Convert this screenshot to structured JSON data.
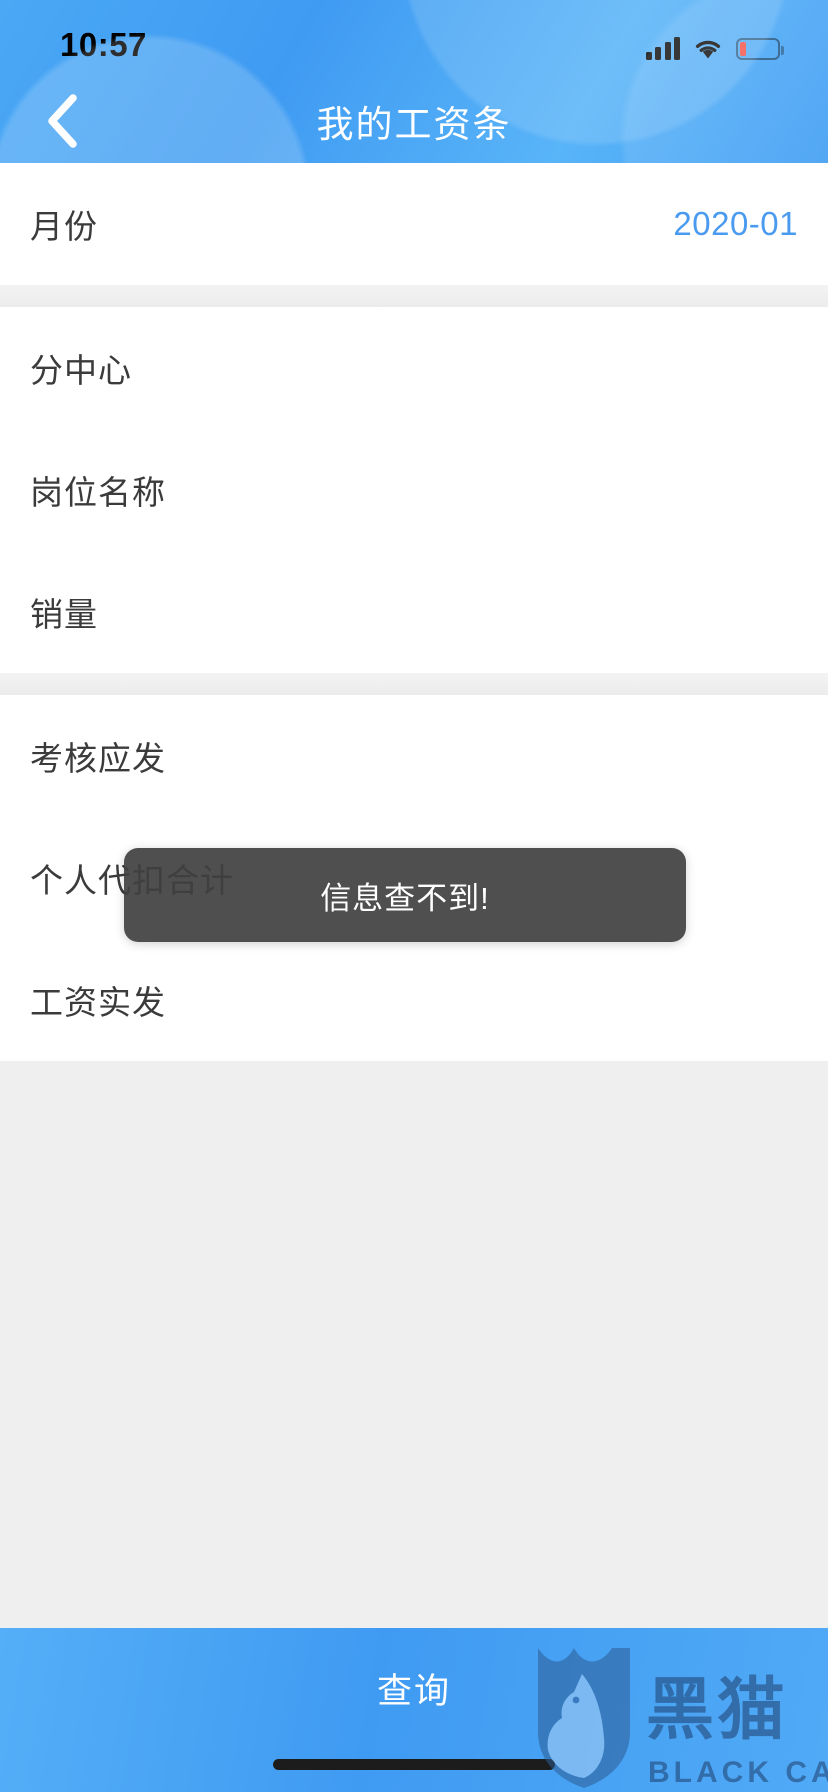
{
  "status_bar": {
    "time": "10:57",
    "signal_icon": "cellular-bars-icon",
    "wifi_icon": "wifi-icon",
    "battery_icon": "battery-low-icon",
    "battery_accent": "#f54a3f"
  },
  "header": {
    "title": "我的工资条",
    "back_icon": "chevron-left-icon",
    "background_color": "#3f9bf2"
  },
  "form": {
    "groups": [
      {
        "rows": [
          {
            "label": "月份",
            "value": "2020-01",
            "value_color": "#4a9bf0"
          }
        ]
      },
      {
        "rows": [
          {
            "label": "分中心",
            "value": ""
          },
          {
            "label": "岗位名称",
            "value": ""
          },
          {
            "label": "销量",
            "value": ""
          }
        ]
      },
      {
        "rows": [
          {
            "label": "考核应发",
            "value": ""
          },
          {
            "label": "个人代扣合计",
            "value": ""
          },
          {
            "label": "工资实发",
            "value": ""
          }
        ]
      }
    ]
  },
  "toast": {
    "message": "信息查不到!",
    "background_color": "#404040"
  },
  "bottom_bar": {
    "query_label": "查询",
    "home_indicator": "home-indicator"
  },
  "watermark": {
    "cn_text": "黑猫",
    "en_text": "BLACK CAT",
    "shield_icon": "black-cat-shield-icon",
    "color": "#1d3f6e"
  }
}
